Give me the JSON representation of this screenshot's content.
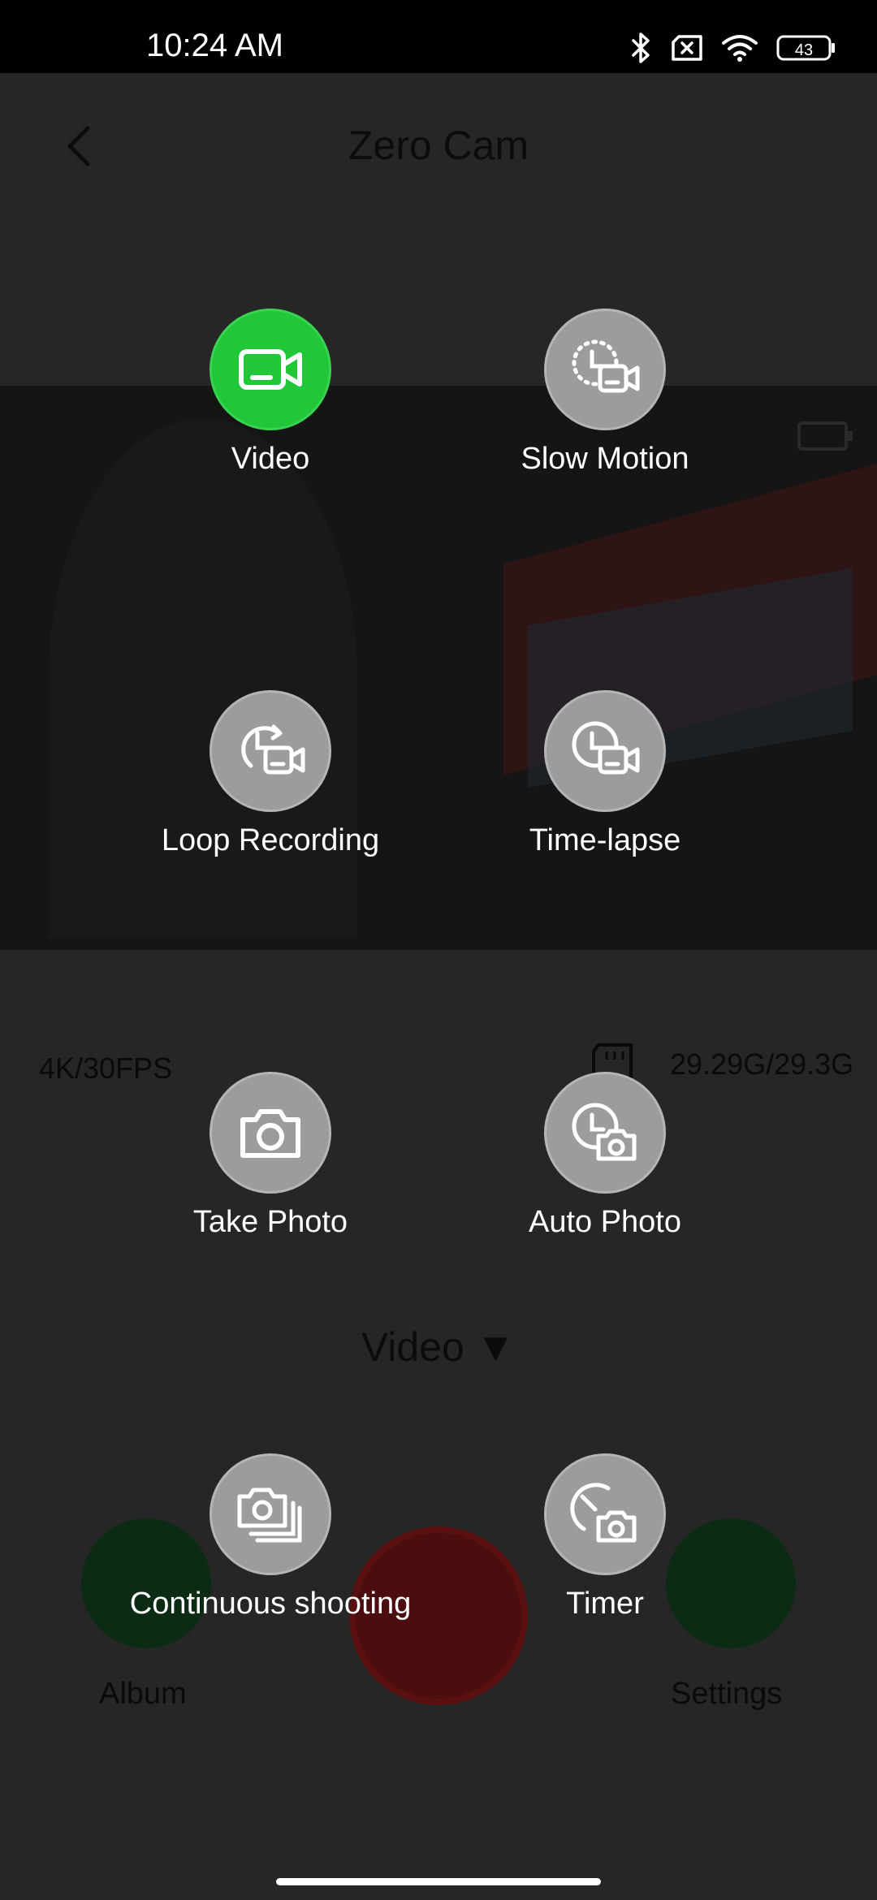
{
  "status_bar": {
    "time": "10:24 AM",
    "battery": "43",
    "icons": [
      "bluetooth-icon",
      "sim-x-icon",
      "wifi-icon",
      "battery-icon"
    ]
  },
  "header": {
    "title": "Zero Cam",
    "back_icon": "chevron-left-icon"
  },
  "camera_info": {
    "resolution": "4K/30FPS",
    "storage": "29.29G/29.3G"
  },
  "mode_selector": {
    "current_mode": "Video ▼"
  },
  "bottom_bar": {
    "album_label": "Album",
    "settings_label": "Settings"
  },
  "modes": [
    {
      "label": "Video",
      "icon": "video-camera-icon",
      "active": true
    },
    {
      "label": "Slow Motion",
      "icon": "slow-motion-icon",
      "active": false
    },
    {
      "label": "Loop Recording",
      "icon": "loop-recording-icon",
      "active": false
    },
    {
      "label": "Time-lapse",
      "icon": "time-lapse-icon",
      "active": false
    },
    {
      "label": "Take Photo",
      "icon": "camera-icon",
      "active": false
    },
    {
      "label": "Auto Photo",
      "icon": "auto-photo-icon",
      "active": false
    },
    {
      "label": "Continuous shooting",
      "icon": "continuous-shooting-icon",
      "active": false
    },
    {
      "label": "Timer",
      "icon": "timer-camera-icon",
      "active": false
    }
  ],
  "colors": {
    "active_mode": "#21c639",
    "inactive_mode": "#9c9c9c",
    "overlay": "#262626"
  }
}
